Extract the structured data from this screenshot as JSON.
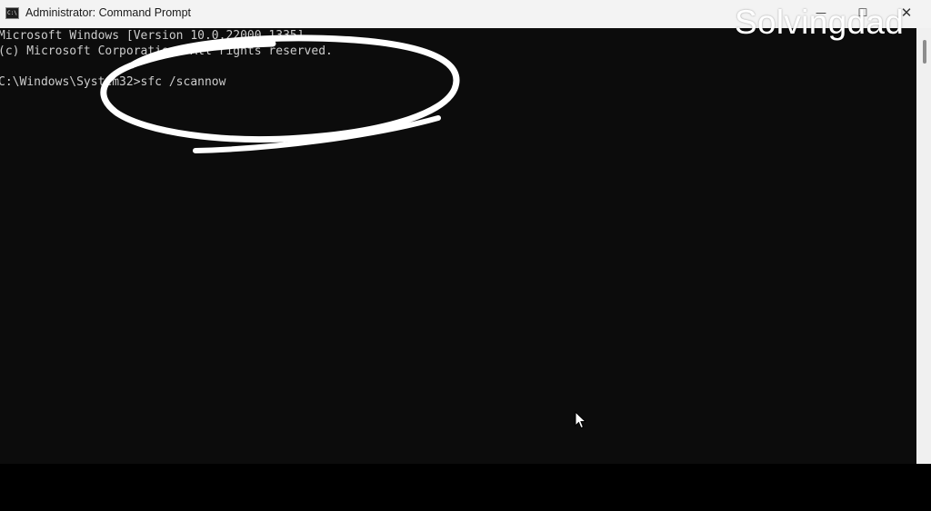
{
  "window": {
    "title": "Administrator: Command Prompt",
    "icon_name": "cmd-app-icon",
    "icon_glyph": "C:\\",
    "controls": {
      "minimize_glyph": "—",
      "maximize_glyph": "☐",
      "close_glyph": "✕"
    }
  },
  "watermark": {
    "text": "Solvingdad"
  },
  "console": {
    "lines": [
      "Microsoft Windows [Version 10.0.22000.1335]",
      "(c) Microsoft Corporation. All rights reserved.",
      "C:\\Windows\\System32>sfc /scannow"
    ],
    "text_color": "#cccccc",
    "background_color": "#0c0c0c"
  },
  "annotation": {
    "shape": "hand-drawn ellipse",
    "color": "#ffffff",
    "highlights": "sfc /scannow"
  },
  "cursor": {
    "icon_name": "mouse-pointer-icon"
  }
}
